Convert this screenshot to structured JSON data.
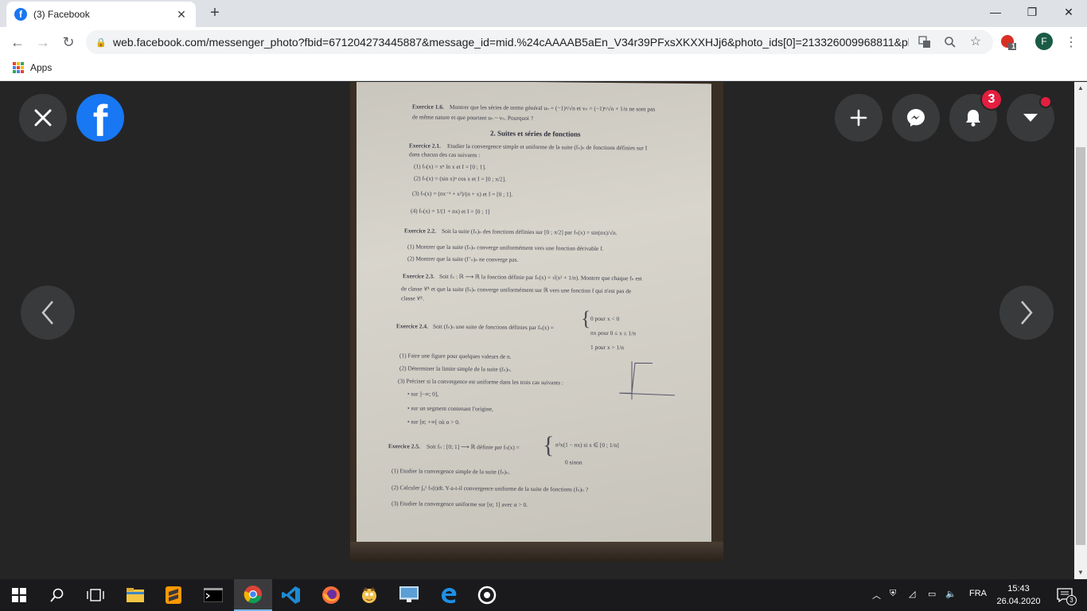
{
  "browser": {
    "tab_title": "(3) Facebook",
    "tab_favicon": "f",
    "url": "web.facebook.com/messenger_photo?fbid=671204273445887&message_id=mid.%24cAAAAB5aEn_V34r39PFxsXKXXHJj6&photo_ids[0]=213326009968811&ph...",
    "profile_initial": "F",
    "extension_badge": "1",
    "bookmarks": {
      "apps_label": "Apps"
    }
  },
  "viewer": {
    "fb_logo": "f",
    "notification_count": "3"
  },
  "paper": {
    "ex16": "Exercice 1.6.",
    "ex16_text": "Montrer que les séries de terme général uₙ = (−1)ⁿ/√n  et vₙ = (−1)ⁿ/√n + 1/n  ne sont pas",
    "ex16_text2": "de même nature et que pourtant uₙ ~ vₙ. Pourquoi ?",
    "section": "2.  Suites et séries de fonctions",
    "ex21": "Exercice 2.1.",
    "ex21_text": "Etudier la convergence simple et uniforme de la suite (fₙ)ₙ de fonctions définies sur I",
    "ex21_text2": "dans chacun des cas suivants :",
    "ex21_1": "(1)  fₙ(x) = xⁿ ln x et I = [0 ; 1].",
    "ex21_2": "(2)  fₙ(x) = (sin x)ⁿ cos x et I = [0 ; π/2].",
    "ex21_3": "(3)  fₙ(x) = (nx⁻¹ + x²)/(n + x)   et I = [0 ; 1].",
    "ex21_4": "(4)  fₙ(x) = 1/(1 + nx)   et I = [0 ; 1]",
    "ex22": "Exercice 2.2.",
    "ex22_text": "Soit la suite (fₙ)ₙ des fonctions définies sur [0 ; π/2] par fₙ(x) = sin(nx)/√n.",
    "ex22_1": "(1)  Montrer que la suite (fₙ)ₙ converge uniformément vers une fonction dérivable f.",
    "ex22_2": "(2)  Montrer que la suite (f’ₙ)ₙ ne converge pas.",
    "ex23": "Exercice 2.3.",
    "ex23_text": "Soit fₙ : ℝ ⟶ ℝ la fonction définie par fₙ(x) = √(x² + 1/n). Montrer que chaque fₙ est",
    "ex23_text2": "de classe 𝒞¹ et que la suite (fₙ)ₙ converge uniformément sur ℝ vers une fonction f qui n'est pas de",
    "ex23_text3": "classe 𝒞¹.",
    "ex24": "Exercice 2.4.",
    "ex24_text": "Soit (fₙ)ₙ une suite de fonctions définies par fₙ(x) =",
    "ex24_c1": "0    pour     x < 0",
    "ex24_c2": "nx   pour   0 ≤ x ≤ 1/n",
    "ex24_c3": "1    pour     x > 1/n",
    "ex24_1": "(1)  Faire une figure pour quelques valeurs de n.",
    "ex24_2": "(2)  Déterminer la limite simple de la suite (fₙ)ₙ.",
    "ex24_3": "(3)  Préciser si la convergence est uniforme dans les trois cas suivants :",
    "ex24_b1": "•  sur ]−∞; 0],",
    "ex24_b2": "•  sur un segment contenant l'origine,",
    "ex24_b3": "•  sur [α; +∞[ où α > 0.",
    "ex25": "Exercice 2.5.",
    "ex25_text": "Soit fₙ : [0; 1] ⟶ ℝ définie par fₙ(x) =",
    "ex25_c1": "n²x(1 − nx)     si     x ∈ [0 ; 1/n]",
    "ex25_c2": "0                   sinon",
    "ex25_1": "(1)  Etudier la convergence simple de la suite (fₙ)ₙ.",
    "ex25_2": "(2)  Calculer ∫₀¹ fₙ(t)dt. Y-a-t-il convergence uniforme de la suite de fonctions (fₙ)ₙ ?",
    "ex25_3": "(3)  Etudier la convergence uniforme sur [α; 1] avec α > 0."
  },
  "taskbar": {
    "language": "FRA",
    "time": "15:43",
    "date": "26.04.2020",
    "notification_count": "3"
  },
  "colors": {
    "facebook_blue": "#1877f2",
    "badge_red": "#e41e3f",
    "viewer_bg": "#252525"
  }
}
